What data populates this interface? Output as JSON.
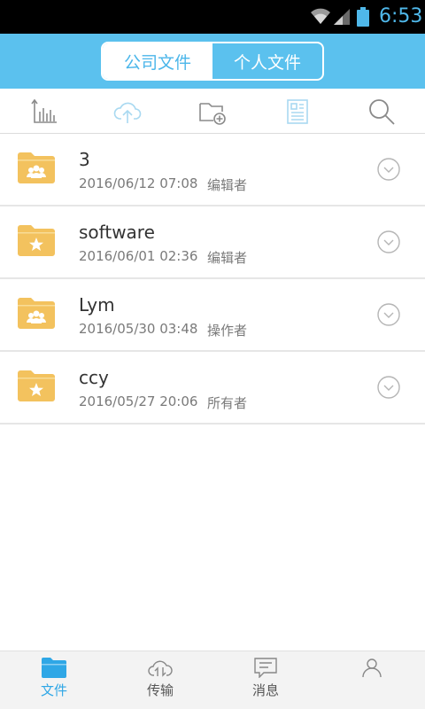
{
  "status_bar": {
    "time": "6:53"
  },
  "header": {
    "tabs": [
      {
        "label": "公司文件",
        "active": true
      },
      {
        "label": "个人文件",
        "active": false
      }
    ]
  },
  "toolbar": {
    "icons": [
      "sort-chart-icon",
      "upload-cloud-icon",
      "new-folder-icon",
      "document-view-icon",
      "search-icon"
    ]
  },
  "files": [
    {
      "name": "3",
      "date": "2016/06/12 07:08",
      "role": "编辑者",
      "folder_type": "shared"
    },
    {
      "name": "software",
      "date": "2016/06/01 02:36",
      "role": "编辑者",
      "folder_type": "starred"
    },
    {
      "name": "Lym",
      "date": "2016/05/30 03:48",
      "role": "操作者",
      "folder_type": "shared"
    },
    {
      "name": "ccy",
      "date": "2016/05/27 20:06",
      "role": "所有者",
      "folder_type": "starred"
    }
  ],
  "bottom_nav": {
    "items": [
      {
        "label": "文件",
        "active": true
      },
      {
        "label": "传输",
        "active": false
      },
      {
        "label": "消息",
        "active": false
      },
      {
        "label": "",
        "active": false
      }
    ]
  },
  "colors": {
    "header_bg": "#5bc1ee",
    "accent": "#2fa7e6",
    "folder": "#f3c25e"
  }
}
